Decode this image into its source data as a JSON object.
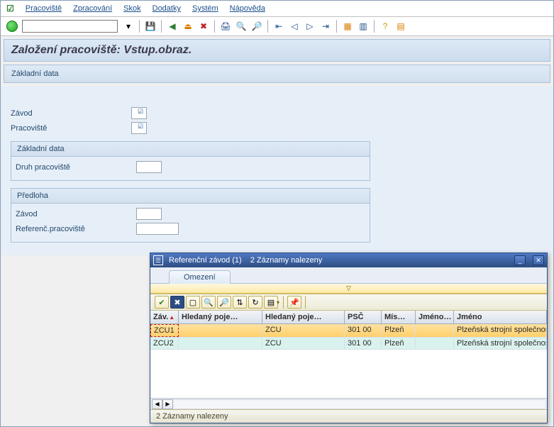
{
  "menu": {
    "items": [
      "Pracoviště",
      "Zpracování",
      "Skok",
      "Dodatky",
      "Systém",
      "Nápověda"
    ]
  },
  "page": {
    "title": "Založení pracoviště: Vstup.obraz.",
    "sublabel": "Základní data"
  },
  "form": {
    "plant_label": "Závod",
    "workcenter_label": "Pracoviště",
    "plant_value": "",
    "workcenter_value": ""
  },
  "panel_basic": {
    "header": "Základní data",
    "type_label": "Druh pracoviště",
    "type_value": ""
  },
  "panel_template": {
    "header": "Předloha",
    "plant_label": "Závod",
    "plant_value": "",
    "ref_label": "Referenč.pracoviště",
    "ref_value": ""
  },
  "popup": {
    "title": "Referenční závod (1)",
    "result_text": "2 Záznamy nalezeny",
    "tab_label": "Omezení",
    "columns": {
      "zav": "Záv.",
      "hp1": "Hledaný poje…",
      "hp2": "Hledaný poje…",
      "psc": "PSČ",
      "mis": "Mís…",
      "jm1": "Jméno…",
      "jm2": "Jméno"
    },
    "rows": [
      {
        "zav": "ZCU1",
        "hp1": "",
        "hp2": "ZCU",
        "psc": "301 00",
        "mis": "Plzeň",
        "jm1": "",
        "jm2": "Plzeňská strojní společnost, a.s."
      },
      {
        "zav": "ZCU2",
        "hp1": "",
        "hp2": "ZCU",
        "psc": "301 00",
        "mis": "Plzeň",
        "jm1": "",
        "jm2": "Plzeňská strojní společnost, a.s."
      }
    ],
    "status": "2 Záznamy nalezeny"
  }
}
